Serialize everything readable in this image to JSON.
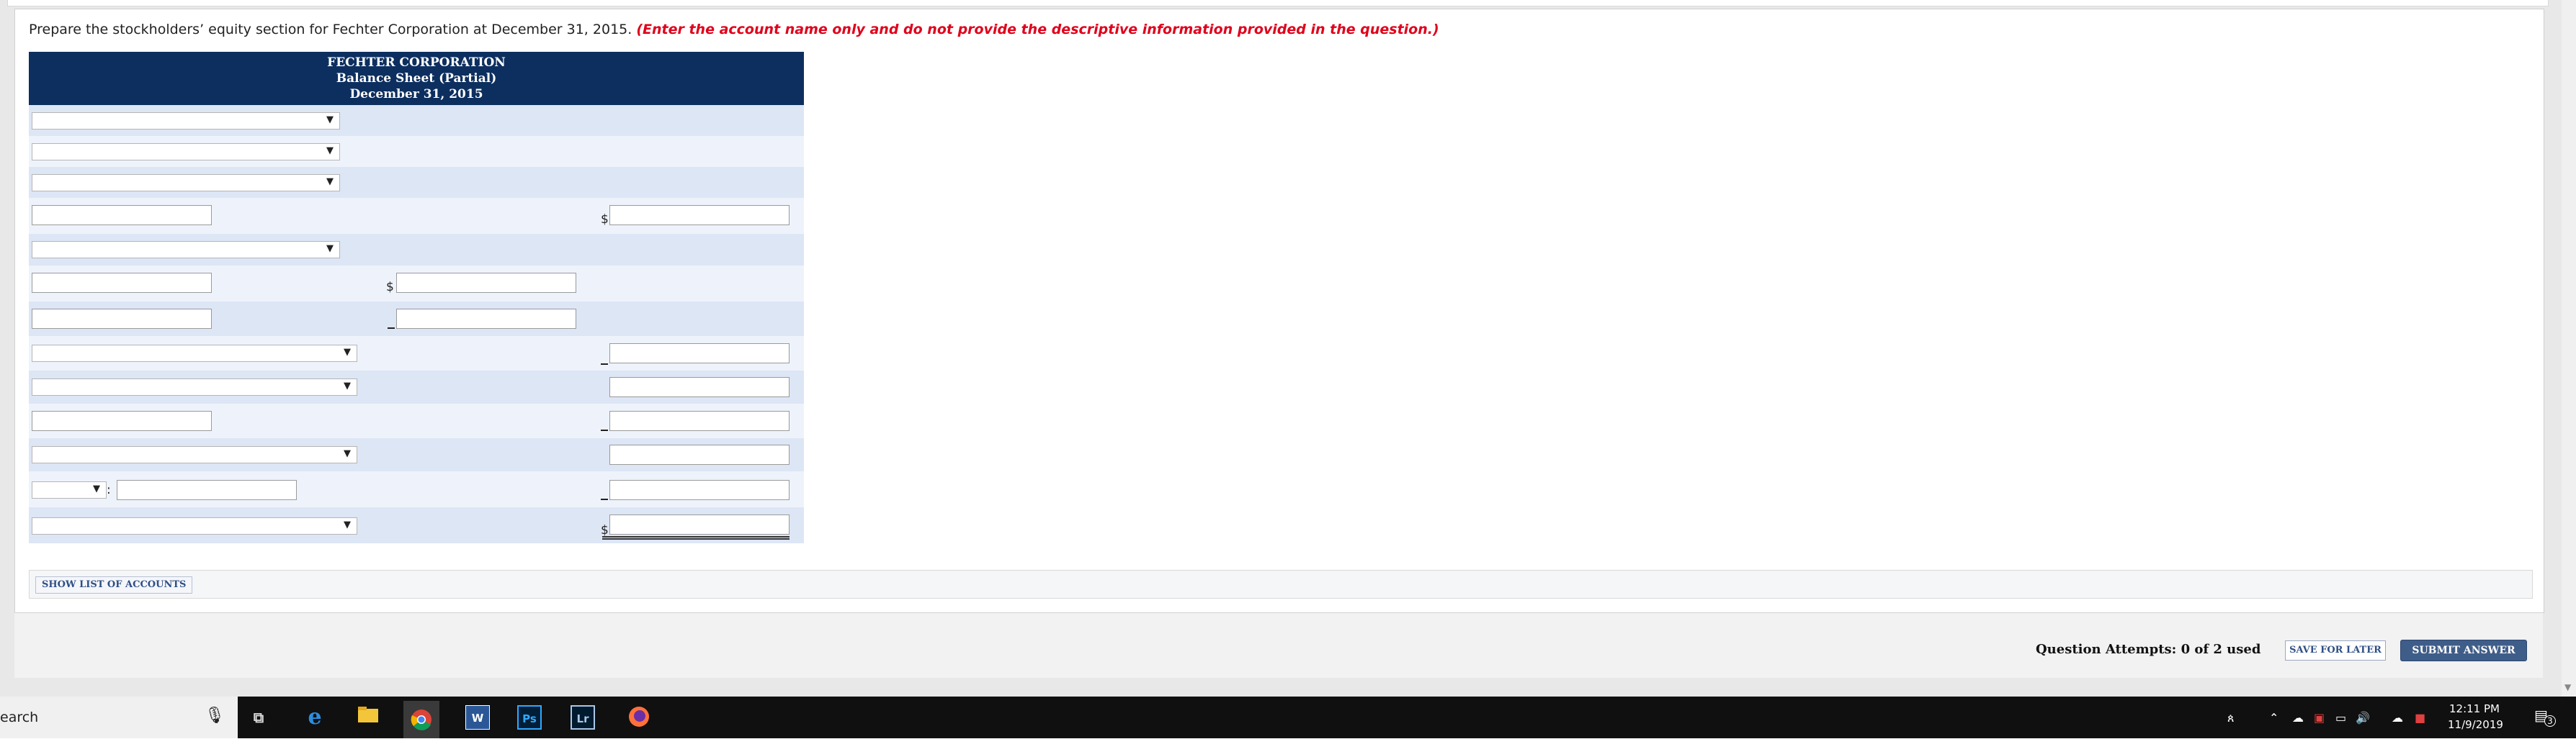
{
  "instruction": {
    "prefix": "Prepare the stockholders’ equity section for Fechter Corporation at December 31, 2015.",
    "emphasis": "(Enter the account name only and do not provide the descriptive information provided in the question.)"
  },
  "statement": {
    "company": "FECHTER CORPORATION",
    "title": "Balance Sheet (Partial)",
    "date": "December 31, 2015"
  },
  "symbols": {
    "dollar": "$",
    "colon": ":",
    "dropdown_arrow": "▼"
  },
  "buttons": {
    "show_accounts": "SHOW LIST OF ACCOUNTS",
    "save": "SAVE FOR LATER",
    "submit": "SUBMIT ANSWER"
  },
  "attempts": "Question Attempts: 0 of 2 used",
  "taskbar": {
    "search_text": "earch",
    "word_label": "W",
    "ps_label": "Ps",
    "lr_label": "Lr",
    "time": "12:11 PM",
    "date": "11/9/2019",
    "notification_count": "3"
  },
  "colors": {
    "header_bg": "#0d2f5f",
    "emphasis_red": "#e0001b",
    "submit_bg": "#3f5d89"
  }
}
